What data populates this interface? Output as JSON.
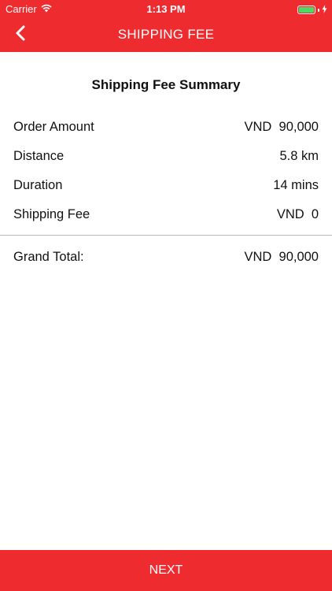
{
  "status_bar": {
    "carrier": "Carrier",
    "time": "1:13 PM",
    "wifi_icon": "wifi-icon",
    "battery_icon": "battery-icon",
    "charging_icon": "bolt-icon",
    "battery_color": "#4cd964"
  },
  "header": {
    "title": "SHIPPING FEE",
    "back_icon": "chevron-left-icon",
    "background": "#ee2b2f"
  },
  "summary": {
    "title": "Shipping Fee Summary",
    "rows": [
      {
        "label": "Order Amount",
        "value": "VND  90,000"
      },
      {
        "label": "Distance",
        "value": "5.8 km"
      },
      {
        "label": "Duration",
        "value": "14 mins"
      },
      {
        "label": "Shipping Fee",
        "value": "VND  0"
      }
    ],
    "grand_total": {
      "label": "Grand Total:",
      "value": "VND  90,000"
    }
  },
  "footer": {
    "next_label": "NEXT"
  }
}
